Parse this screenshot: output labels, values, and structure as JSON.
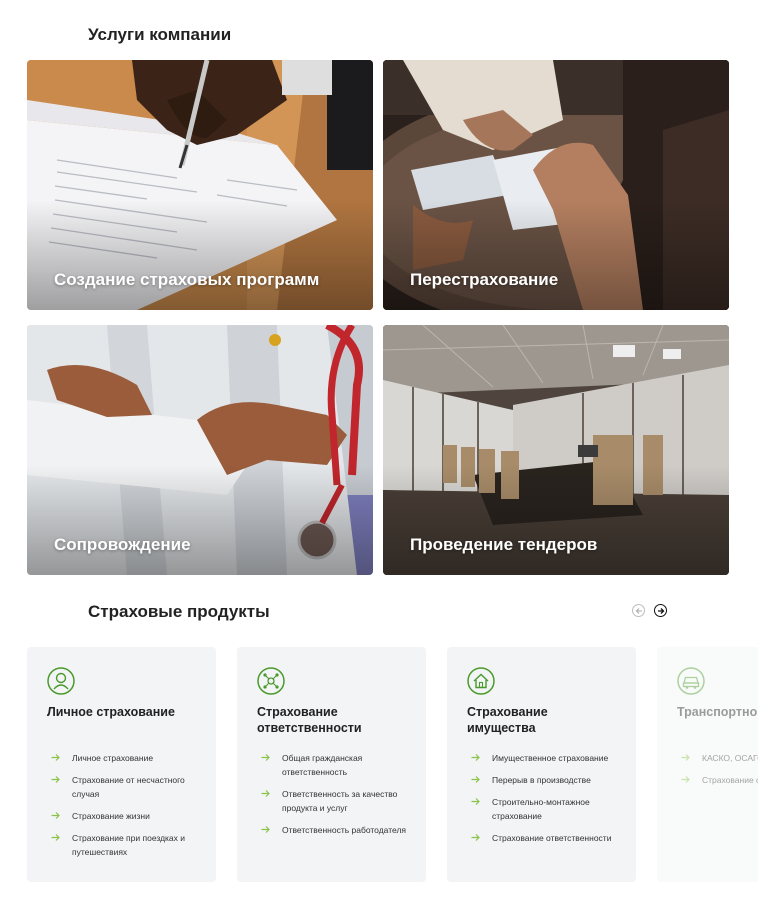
{
  "services": {
    "title": "Услуги компании",
    "tiles": [
      {
        "label": "Создание страховых программ"
      },
      {
        "label": "Перестрахование"
      },
      {
        "label": "Сопровождение"
      },
      {
        "label": "Проведение тендеров"
      }
    ]
  },
  "products": {
    "title": "Страховые продукты",
    "cards": [
      {
        "icon": "person-icon",
        "title": "Личное страхование",
        "items": [
          "Личное страхование",
          "Страхование от несчастного случая",
          "Страхование жизни",
          "Страхование при поездках и путешествиях"
        ]
      },
      {
        "icon": "network-icon",
        "title": "Страхование\nответственности",
        "items": [
          "Общая гражданская ответственность",
          "Ответственность за качество продукта и услуг",
          "Ответственность работодателя"
        ]
      },
      {
        "icon": "house-icon",
        "title": "Страхование\nимущества",
        "items": [
          "Имущественное страхование",
          "Перерыв в производстве",
          "Строительно-монтажное страхование",
          "Страхование ответственности"
        ]
      },
      {
        "icon": "car-icon",
        "title": "Транспортно\nстрахование",
        "items": [
          "КАСКО, ОСАГО",
          "Страхование с случаев на тра"
        ]
      }
    ]
  },
  "colors": {
    "accent": "#4a9a2a",
    "card_bg": "#f3f4f6"
  }
}
